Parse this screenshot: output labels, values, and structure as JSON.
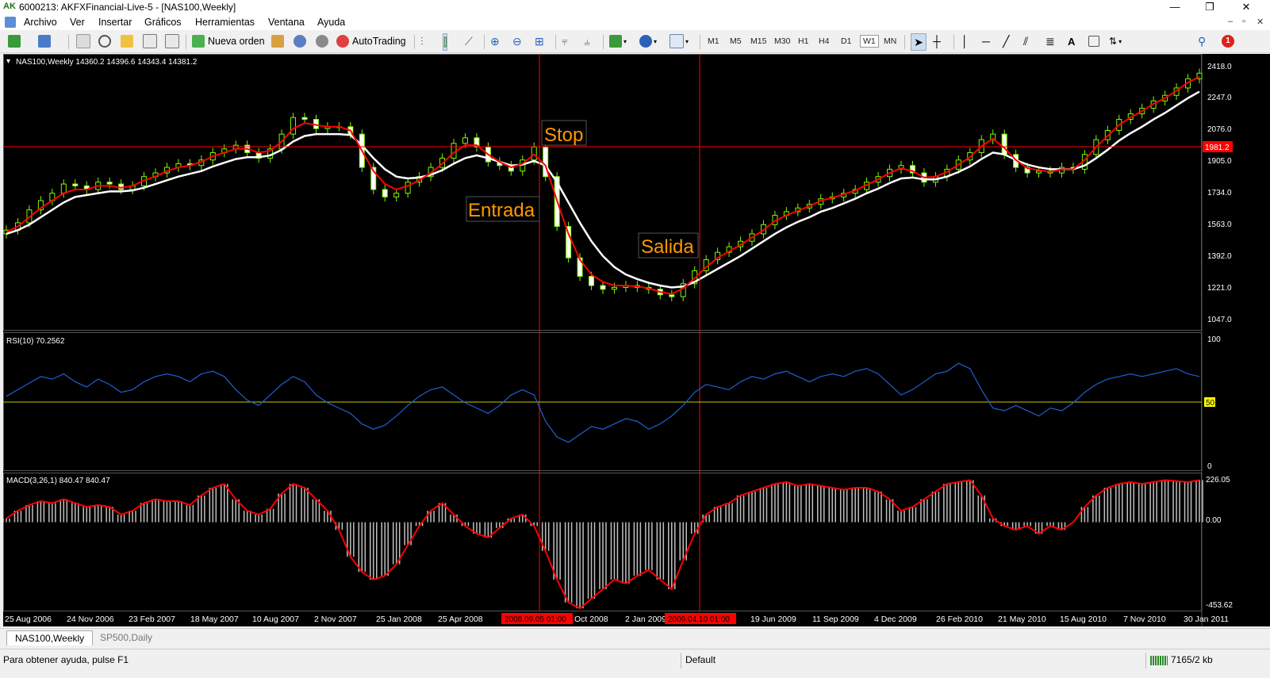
{
  "window": {
    "title": "6000213: AKFXFinancial-Live-5 - [NAS100,Weekly]",
    "logo_text": "AK",
    "minimize": "—",
    "maximize": "❐",
    "close": "✕"
  },
  "menu": {
    "items": [
      "Archivo",
      "Ver",
      "Insertar",
      "Gráficos",
      "Herramientas",
      "Ventana",
      "Ayuda"
    ],
    "mdi": [
      "–",
      "▫",
      "✕"
    ]
  },
  "toolbar": {
    "new_order": "Nueva orden",
    "autotrading": "AutoTrading",
    "timeframes": [
      "M1",
      "M5",
      "M15",
      "M30",
      "H1",
      "H4",
      "D1",
      "W1",
      "MN"
    ],
    "active_timeframe": "W1",
    "text_tool": "A",
    "notification_count": "1"
  },
  "chart": {
    "header": "NAS100,Weekly  14360.2 14396.6 14343.4 14381.2",
    "price_ticks": [
      "2418.0",
      "2247.0",
      "2076.0",
      "1905.0",
      "1734.0",
      "1563.0",
      "1392.0",
      "1221.0",
      "1047.0"
    ],
    "current_price_label": "1981.2",
    "annotations": {
      "stop": "Stop",
      "entry": "Entrada",
      "exit": "Salida"
    },
    "rsi_header": "RSI(10) 70.2562",
    "rsi_ticks": [
      "100",
      "50",
      "0"
    ],
    "macd_header": "MACD(3,26,1) 840.47 840.47",
    "macd_ticks": [
      "226.05",
      "0.00",
      "-453.62"
    ],
    "date_labels": [
      "25 Aug 2006",
      "24 Nov 2006",
      "23 Feb 2007",
      "18 May 2007",
      "10 Aug 2007",
      "2 Nov 2007",
      "25 Jan 2008",
      "25 Apr 2008",
      "Oct 2008",
      "2 Jan 2009",
      "19 Jun 2009",
      "11 Sep 2009",
      "4 Dec 2009",
      "26 Feb 2010",
      "21 May 2010",
      "15 Aug 2010",
      "7 Nov 2010",
      "30 Jan 2011"
    ],
    "vline_entry_label": "2008.09.05 01:00",
    "vline_exit_label": "2009.04.10 01:00",
    "colors": {
      "background": "#000000",
      "candle": "#7cfc00",
      "ema_fast": "#ff0000",
      "ema_slow": "#ffffff",
      "rsi": "#1e60d0",
      "rsi_level": "#c8c800",
      "macd_hist": "#c0c0c0",
      "macd_signal": "#ff0000",
      "annotation": "#ff9900",
      "crosshair": "#ff0000"
    }
  },
  "chart_data": {
    "type": "candlestick",
    "symbol": "NAS100",
    "timeframe": "Weekly",
    "ylim": [
      1000,
      2460
    ],
    "close_polyline": [
      1540,
      1580,
      1650,
      1700,
      1740,
      1790,
      1780,
      1760,
      1800,
      1790,
      1760,
      1780,
      1830,
      1850,
      1880,
      1900,
      1890,
      1920,
      1960,
      1980,
      2000,
      1960,
      1930,
      1980,
      2060,
      2150,
      2140,
      2090,
      2100,
      2100,
      2060,
      1880,
      1760,
      1720,
      1740,
      1800,
      1830,
      1880,
      1930,
      2010,
      2040,
      1990,
      1910,
      1890,
      1860,
      1920,
      1990,
      1830,
      1560,
      1390,
      1290,
      1240,
      1220,
      1230,
      1240,
      1230,
      1220,
      1190,
      1180,
      1250,
      1320,
      1380,
      1420,
      1450,
      1480,
      1520,
      1570,
      1620,
      1640,
      1660,
      1680,
      1710,
      1720,
      1740,
      1760,
      1800,
      1830,
      1870,
      1890,
      1850,
      1800,
      1830,
      1870,
      1920,
      1960,
      2030,
      2060,
      1950,
      1880,
      1850,
      1860,
      1850,
      1880,
      1870,
      1950,
      2030,
      2080,
      2140,
      2170,
      2200,
      2240,
      2270,
      2310,
      2360,
      2390
    ],
    "ema_fast": [
      1530,
      1560,
      1610,
      1660,
      1700,
      1740,
      1760,
      1760,
      1780,
      1780,
      1770,
      1780,
      1810,
      1830,
      1860,
      1880,
      1890,
      1910,
      1940,
      1960,
      1980,
      1980,
      1960,
      1970,
      2020,
      2090,
      2120,
      2110,
      2100,
      2100,
      2080,
      1970,
      1860,
      1790,
      1760,
      1780,
      1810,
      1850,
      1900,
      1960,
      2000,
      2000,
      1950,
      1910,
      1880,
      1900,
      1950,
      1890,
      1700,
      1520,
      1380,
      1300,
      1260,
      1240,
      1240,
      1235,
      1225,
      1205,
      1195,
      1225,
      1280,
      1340,
      1390,
      1425,
      1460,
      1500,
      1540,
      1590,
      1620,
      1645,
      1670,
      1700,
      1715,
      1735,
      1755,
      1785,
      1815,
      1850,
      1875,
      1860,
      1825,
      1830,
      1855,
      1895,
      1935,
      1995,
      2035,
      1985,
      1920,
      1875,
      1865,
      1855,
      1870,
      1870,
      1920,
      1990,
      2050,
      2110,
      2150,
      2185,
      2225,
      2255,
      2295,
      2340,
      2370
    ],
    "ema_slow": [
      1520,
      1540,
      1570,
      1610,
      1650,
      1690,
      1720,
      1730,
      1740,
      1750,
      1750,
      1755,
      1770,
      1790,
      1810,
      1830,
      1845,
      1860,
      1885,
      1905,
      1925,
      1935,
      1935,
      1945,
      1975,
      2020,
      2050,
      2060,
      2060,
      2060,
      2055,
      2000,
      1930,
      1870,
      1830,
      1820,
      1825,
      1840,
      1865,
      1900,
      1930,
      1945,
      1930,
      1910,
      1890,
      1895,
      1915,
      1890,
      1800,
      1690,
      1580,
      1480,
      1400,
      1340,
      1300,
      1275,
      1255,
      1240,
      1230,
      1235,
      1260,
      1295,
      1330,
      1365,
      1400,
      1440,
      1480,
      1520,
      1555,
      1585,
      1610,
      1640,
      1660,
      1685,
      1710,
      1740,
      1765,
      1795,
      1820,
      1825,
      1815,
      1815,
      1830,
      1855,
      1885,
      1925,
      1960,
      1950,
      1920,
      1895,
      1880,
      1870,
      1870,
      1870,
      1890,
      1930,
      1975,
      2025,
      2065,
      2100,
      2140,
      2175,
      2215,
      2255,
      2290
    ],
    "rsi": [
      55,
      60,
      65,
      70,
      68,
      72,
      66,
      62,
      68,
      64,
      58,
      60,
      66,
      70,
      72,
      70,
      66,
      72,
      74,
      70,
      60,
      52,
      48,
      56,
      64,
      70,
      66,
      56,
      50,
      46,
      42,
      34,
      30,
      33,
      40,
      48,
      55,
      60,
      62,
      56,
      50,
      46,
      42,
      48,
      56,
      60,
      56,
      36,
      24,
      20,
      26,
      32,
      30,
      34,
      38,
      36,
      30,
      34,
      40,
      48,
      58,
      64,
      62,
      60,
      66,
      70,
      68,
      72,
      74,
      70,
      66,
      70,
      72,
      70,
      74,
      76,
      72,
      64,
      56,
      60,
      66,
      72,
      74,
      80,
      76,
      60,
      46,
      44,
      48,
      44,
      40,
      46,
      44,
      50,
      58,
      64,
      68,
      70,
      72,
      70,
      72,
      74,
      76,
      72,
      70
    ],
    "rsi_level": 50,
    "macd": [
      20,
      60,
      90,
      110,
      100,
      120,
      100,
      80,
      90,
      80,
      40,
      60,
      100,
      120,
      110,
      110,
      90,
      140,
      180,
      200,
      120,
      60,
      40,
      70,
      150,
      200,
      180,
      120,
      60,
      -40,
      -180,
      -260,
      -300,
      -280,
      -220,
      -120,
      -20,
      60,
      100,
      40,
      -20,
      -60,
      -80,
      -30,
      20,
      40,
      -20,
      -150,
      -300,
      -420,
      -450,
      -400,
      -350,
      -300,
      -320,
      -280,
      -250,
      -300,
      -350,
      -200,
      -60,
      40,
      80,
      100,
      140,
      160,
      180,
      200,
      210,
      190,
      200,
      190,
      180,
      170,
      180,
      180,
      160,
      120,
      60,
      80,
      120,
      160,
      200,
      210,
      220,
      140,
      20,
      -20,
      -40,
      -20,
      -60,
      -20,
      -40,
      0,
      80,
      140,
      180,
      200,
      210,
      200,
      210,
      220,
      215,
      210,
      220
    ],
    "macd_ylim": [
      -453.62,
      226.05
    ]
  }
}
